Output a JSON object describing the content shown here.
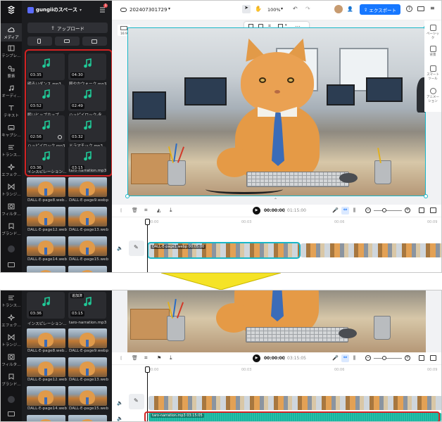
{
  "top": {
    "workspace": "gungiiのスペース",
    "notification_badge": "1",
    "rail": [
      {
        "label": "メディア",
        "icon": "cloud-icon"
      },
      {
        "label": "テンプレ…",
        "icon": "template-icon"
      },
      {
        "label": "要素",
        "icon": "shapes-icon"
      },
      {
        "label": "オーディ…",
        "icon": "music-icon"
      },
      {
        "label": "テキスト",
        "icon": "text-icon"
      },
      {
        "label": "キャプシ…",
        "icon": "caption-icon"
      },
      {
        "label": "トランス…",
        "icon": "transcript-icon"
      },
      {
        "label": "エフェク…",
        "icon": "effects-icon"
      },
      {
        "label": "トランジ…",
        "icon": "transition-icon"
      },
      {
        "label": "フィルタ…",
        "icon": "filter-icon"
      },
      {
        "label": "ブランド…",
        "icon": "brand-icon"
      }
    ],
    "upload_label": "アップロード",
    "audio_tiles": [
      {
        "dur": "03:35",
        "name": "明るいダンス.mp3"
      },
      {
        "dur": "04:30",
        "name": "軽やかウォーク.mp3"
      },
      {
        "dur": "03:52",
        "name": "眠いヒップホップ…"
      },
      {
        "dur": "02:49",
        "name": "ハッピイロック-永…"
      },
      {
        "dur": "02:56",
        "name": "ハッピイロック.mp3"
      },
      {
        "dur": "03:32",
        "name": "ドラマチック.mp3"
      },
      {
        "dur": "03:36",
        "name": "インスピレーション…"
      },
      {
        "dur": "03:15",
        "name": "taro-narration.mp3"
      }
    ],
    "images": [
      {
        "name": "DALL·E-page8.web…"
      },
      {
        "name": "DALL·E-page9.webp"
      },
      {
        "name": "DALL·E-page12.web…"
      },
      {
        "name": "DALL·E-page13.web…"
      },
      {
        "name": "DALL·E-page14.web…"
      },
      {
        "name": "DALL·E-page15.web…"
      }
    ],
    "project_name": "202407301729",
    "zoom": "100%",
    "export_label": "エクスポート",
    "aspect_label": "16:9",
    "right_tools": [
      "ベーシック",
      "背景",
      "スマート ツール",
      "アニメーション"
    ],
    "time_current": "00:00:00",
    "time_total": "01:15:00",
    "ruler": [
      "00:00",
      "00:03",
      "00:06",
      "00:09"
    ],
    "clip_label": "DALL·E-page1.webp  00:05:00"
  },
  "bottom": {
    "rail": [
      {
        "label": "トランス…",
        "icon": "transcript-icon"
      },
      {
        "label": "エフェク…",
        "icon": "effects-icon"
      },
      {
        "label": "トランジ…",
        "icon": "transition-icon"
      },
      {
        "label": "フィルタ…",
        "icon": "filter-icon"
      },
      {
        "label": "ブランド…",
        "icon": "brand-icon"
      }
    ],
    "audio_tiles": [
      {
        "dur": "03:36",
        "name": "インスピレーション…"
      },
      {
        "dur": "03:15",
        "name": "taro-narration.mp3",
        "badge": "追加済"
      }
    ],
    "images": [
      {
        "name": "DALL·E-page8.web…"
      },
      {
        "name": "DALL·E-page9.webp"
      },
      {
        "name": "DALL·E-page12.web…"
      },
      {
        "name": "DALL·E-page13.web…"
      },
      {
        "name": "DALL·E-page14.web…"
      },
      {
        "name": "DALL·E-page15.web…"
      }
    ],
    "time_current": "00:00:00",
    "time_total": "03:15:05",
    "ruler": [
      "00:00",
      "00:03",
      "00:06",
      "00:09"
    ],
    "audio_clip_label": "taro-narration.mp3  03:15:05"
  },
  "colors": {
    "accent": "#1677ff",
    "teal_audio": "#17b6a0",
    "highlight": "#d32222",
    "arrow": "#f5e326"
  }
}
